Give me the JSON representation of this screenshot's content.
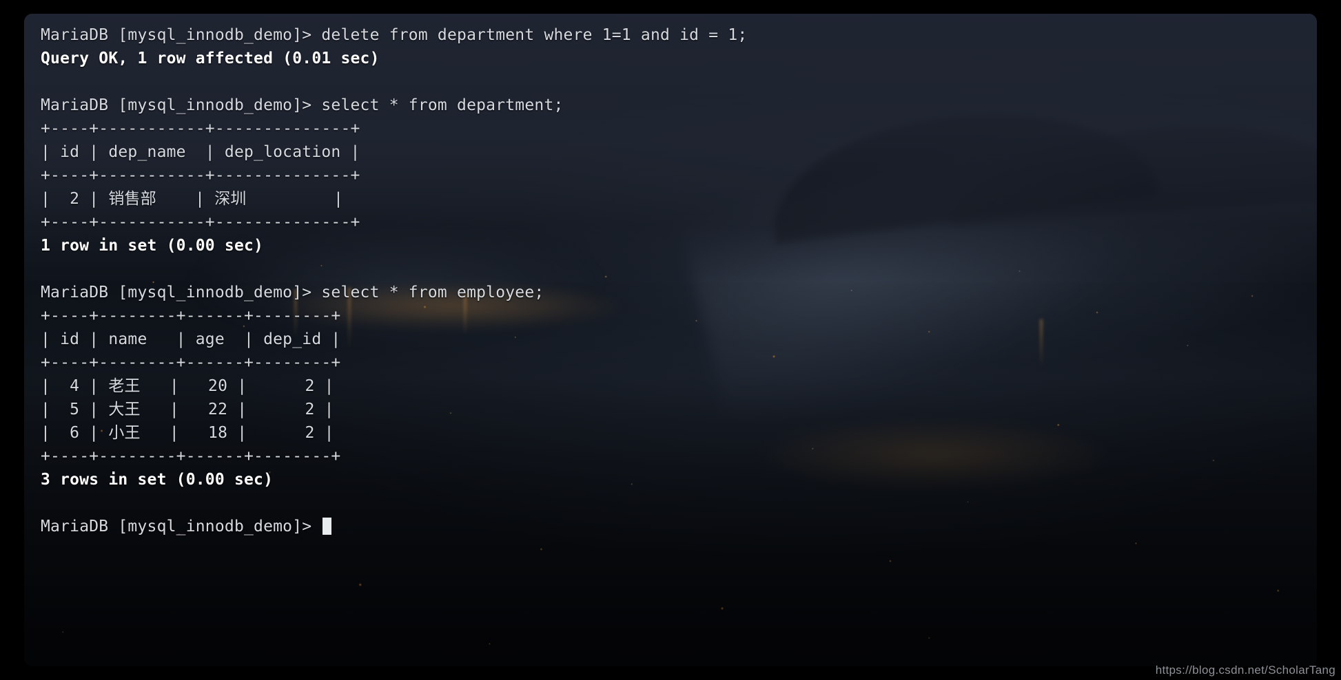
{
  "window": {
    "prompt": "MariaDB [mysql_innodb_demo]> ",
    "database": "mysql_innodb_demo",
    "client": "MariaDB",
    "cursor": "block-cursor"
  },
  "watermark": {
    "text": "https://blog.csdn.net/ScholarTang"
  },
  "colors": {
    "background": "#000000",
    "terminal_tint": "#1e2330",
    "text": "#d6d9de",
    "bold_text": "#ffffff",
    "cursor": "#e9ecef",
    "watermark": "#8d9198",
    "city_light": "#ffa84a"
  },
  "terminal": {
    "lines": [
      {
        "id": "l01",
        "text": "MariaDB [mysql_innodb_demo]> delete from department where 1=1 and id = 1;",
        "style": "normal"
      },
      {
        "id": "l02",
        "text": "Query OK, 1 row affected (0.01 sec)",
        "style": "bold"
      },
      {
        "id": "l03",
        "text": "",
        "style": "blank"
      },
      {
        "id": "l04",
        "text": "MariaDB [mysql_innodb_demo]> select * from department;",
        "style": "normal"
      },
      {
        "id": "l05",
        "text": "+----+-----------+--------------+",
        "style": "normal"
      },
      {
        "id": "l06",
        "text": "| id | dep_name  | dep_location |",
        "style": "normal"
      },
      {
        "id": "l07",
        "text": "+----+-----------+--------------+",
        "style": "normal"
      },
      {
        "id": "l08",
        "text": "|  2 | 销售部    | 深圳         |",
        "style": "normal"
      },
      {
        "id": "l09",
        "text": "+----+-----------+--------------+",
        "style": "normal"
      },
      {
        "id": "l10",
        "text": "1 row in set (0.00 sec)",
        "style": "bold"
      },
      {
        "id": "l11",
        "text": "",
        "style": "blank"
      },
      {
        "id": "l12",
        "text": "MariaDB [mysql_innodb_demo]> select * from employee;",
        "style": "normal"
      },
      {
        "id": "l13",
        "text": "+----+--------+------+--------+",
        "style": "normal"
      },
      {
        "id": "l14",
        "text": "| id | name   | age  | dep_id |",
        "style": "normal"
      },
      {
        "id": "l15",
        "text": "+----+--------+------+--------+",
        "style": "normal"
      },
      {
        "id": "l16",
        "text": "|  4 | 老王   |   20 |      2 |",
        "style": "normal"
      },
      {
        "id": "l17",
        "text": "|  5 | 大王   |   22 |      2 |",
        "style": "normal"
      },
      {
        "id": "l18",
        "text": "|  6 | 小王   |   18 |      2 |",
        "style": "normal"
      },
      {
        "id": "l19",
        "text": "+----+--------+------+--------+",
        "style": "normal"
      },
      {
        "id": "l20",
        "text": "3 rows in set (0.00 sec)",
        "style": "bold"
      },
      {
        "id": "l21",
        "text": "",
        "style": "blank"
      },
      {
        "id": "l22",
        "text": "MariaDB [mysql_innodb_demo]> ",
        "style": "prompt-cursor"
      }
    ],
    "commands": [
      {
        "sql": "delete from department where 1=1 and id = 1;",
        "result": "Query OK, 1 row affected (0.01 sec)"
      },
      {
        "sql": "select * from department;",
        "result": "1 row in set (0.00 sec)"
      },
      {
        "sql": "select * from employee;",
        "result": "3 rows in set (0.00 sec)"
      }
    ],
    "result_tables": [
      {
        "name": "department",
        "columns": [
          "id",
          "dep_name",
          "dep_location"
        ],
        "rows": [
          [
            "2",
            "销售部",
            "深圳"
          ]
        ],
        "footer": "1 row in set (0.00 sec)"
      },
      {
        "name": "employee",
        "columns": [
          "id",
          "name",
          "age",
          "dep_id"
        ],
        "rows": [
          [
            "4",
            "老王",
            "20",
            "2"
          ],
          [
            "5",
            "大王",
            "22",
            "2"
          ],
          [
            "6",
            "小王",
            "18",
            "2"
          ]
        ],
        "footer": "3 rows in set (0.00 sec)"
      }
    ]
  }
}
